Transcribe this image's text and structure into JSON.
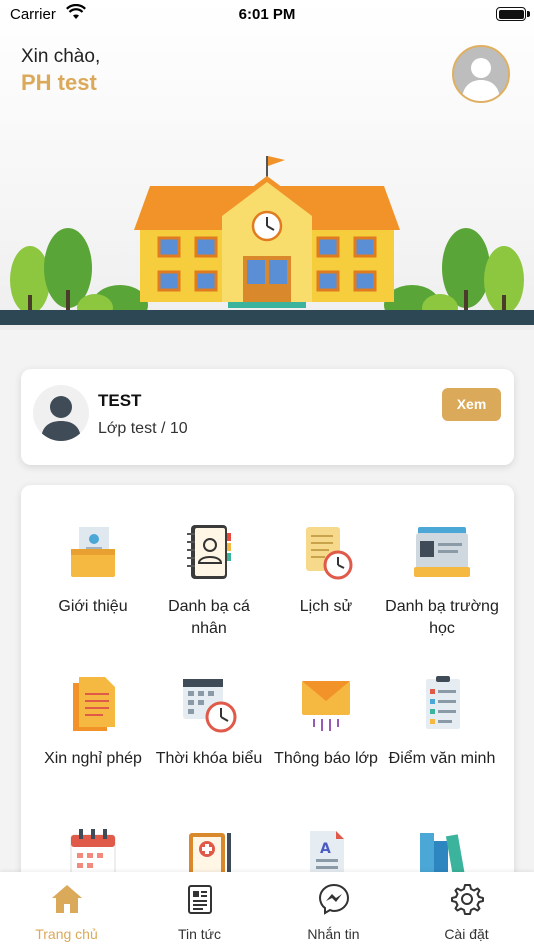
{
  "status_bar": {
    "carrier": "Carrier",
    "time": "6:01 PM"
  },
  "header": {
    "greeting": "Xin chào,",
    "username": "PH test"
  },
  "student": {
    "name": "TEST",
    "class": "Lớp test / 10",
    "view_label": "Xem"
  },
  "menu": [
    {
      "label": "Giới thiệu",
      "icon": "folder-profile-icon"
    },
    {
      "label": "Danh bạ cá nhân",
      "icon": "contact-book-icon"
    },
    {
      "label": "Lịch sử",
      "icon": "history-scroll-icon"
    },
    {
      "label": "Danh bạ trường học",
      "icon": "id-cards-icon"
    },
    {
      "label": "Xin nghỉ phép",
      "icon": "leave-document-icon"
    },
    {
      "label": "Thời khóa biểu",
      "icon": "timetable-icon"
    },
    {
      "label": "Thông báo lớp",
      "icon": "envelope-icon"
    },
    {
      "label": "Điểm văn minh",
      "icon": "checklist-icon"
    },
    {
      "label": "",
      "icon": "calendar-icon"
    },
    {
      "label": "",
      "icon": "medical-clipboard-icon"
    },
    {
      "label": "",
      "icon": "grades-document-icon"
    },
    {
      "label": "",
      "icon": "books-icon"
    }
  ],
  "tabs": [
    {
      "label": "Trang chủ",
      "icon": "home-icon",
      "active": true
    },
    {
      "label": "Tin tức",
      "icon": "news-icon",
      "active": false
    },
    {
      "label": "Nhắn tin",
      "icon": "messenger-icon",
      "active": false
    },
    {
      "label": "Cài đặt",
      "icon": "gear-icon",
      "active": false
    }
  ],
  "colors": {
    "accent": "#dba95a",
    "text": "#222222",
    "school_wall": "#f5cd3d",
    "school_roof": "#f2932a"
  }
}
